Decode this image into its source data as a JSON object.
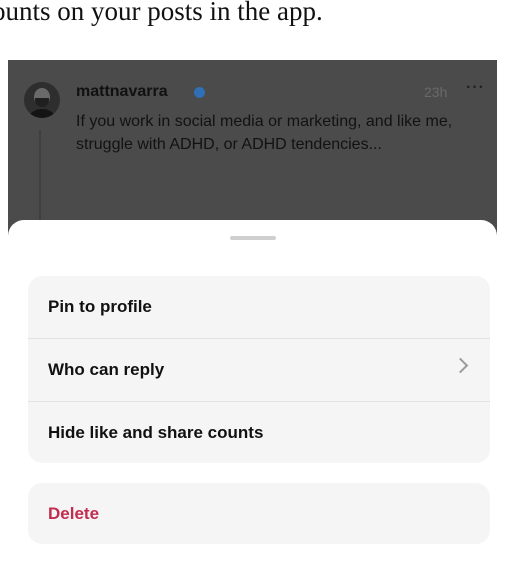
{
  "article": {
    "caption": "ounts on your posts in the app."
  },
  "post": {
    "username": "mattnavarra",
    "verified": true,
    "time": "23h",
    "more": "···",
    "text": "If you work in social media or marketing, and like me, struggle with ADHD, or ADHD tendencies..."
  },
  "sheet": {
    "options": [
      {
        "label": "Pin to profile"
      },
      {
        "label": "Who can reply"
      },
      {
        "label": "Hide like and share counts"
      }
    ],
    "delete_label": "Delete"
  },
  "colors": {
    "overlay": "#4b4b4b",
    "verified": "#2f6fb5",
    "danger": "#c42c4e",
    "group_bg": "#f5f5f5"
  },
  "icons": [
    "verified-badge-icon",
    "more-options-icon",
    "chevron-right-icon",
    "drag-handle"
  ]
}
